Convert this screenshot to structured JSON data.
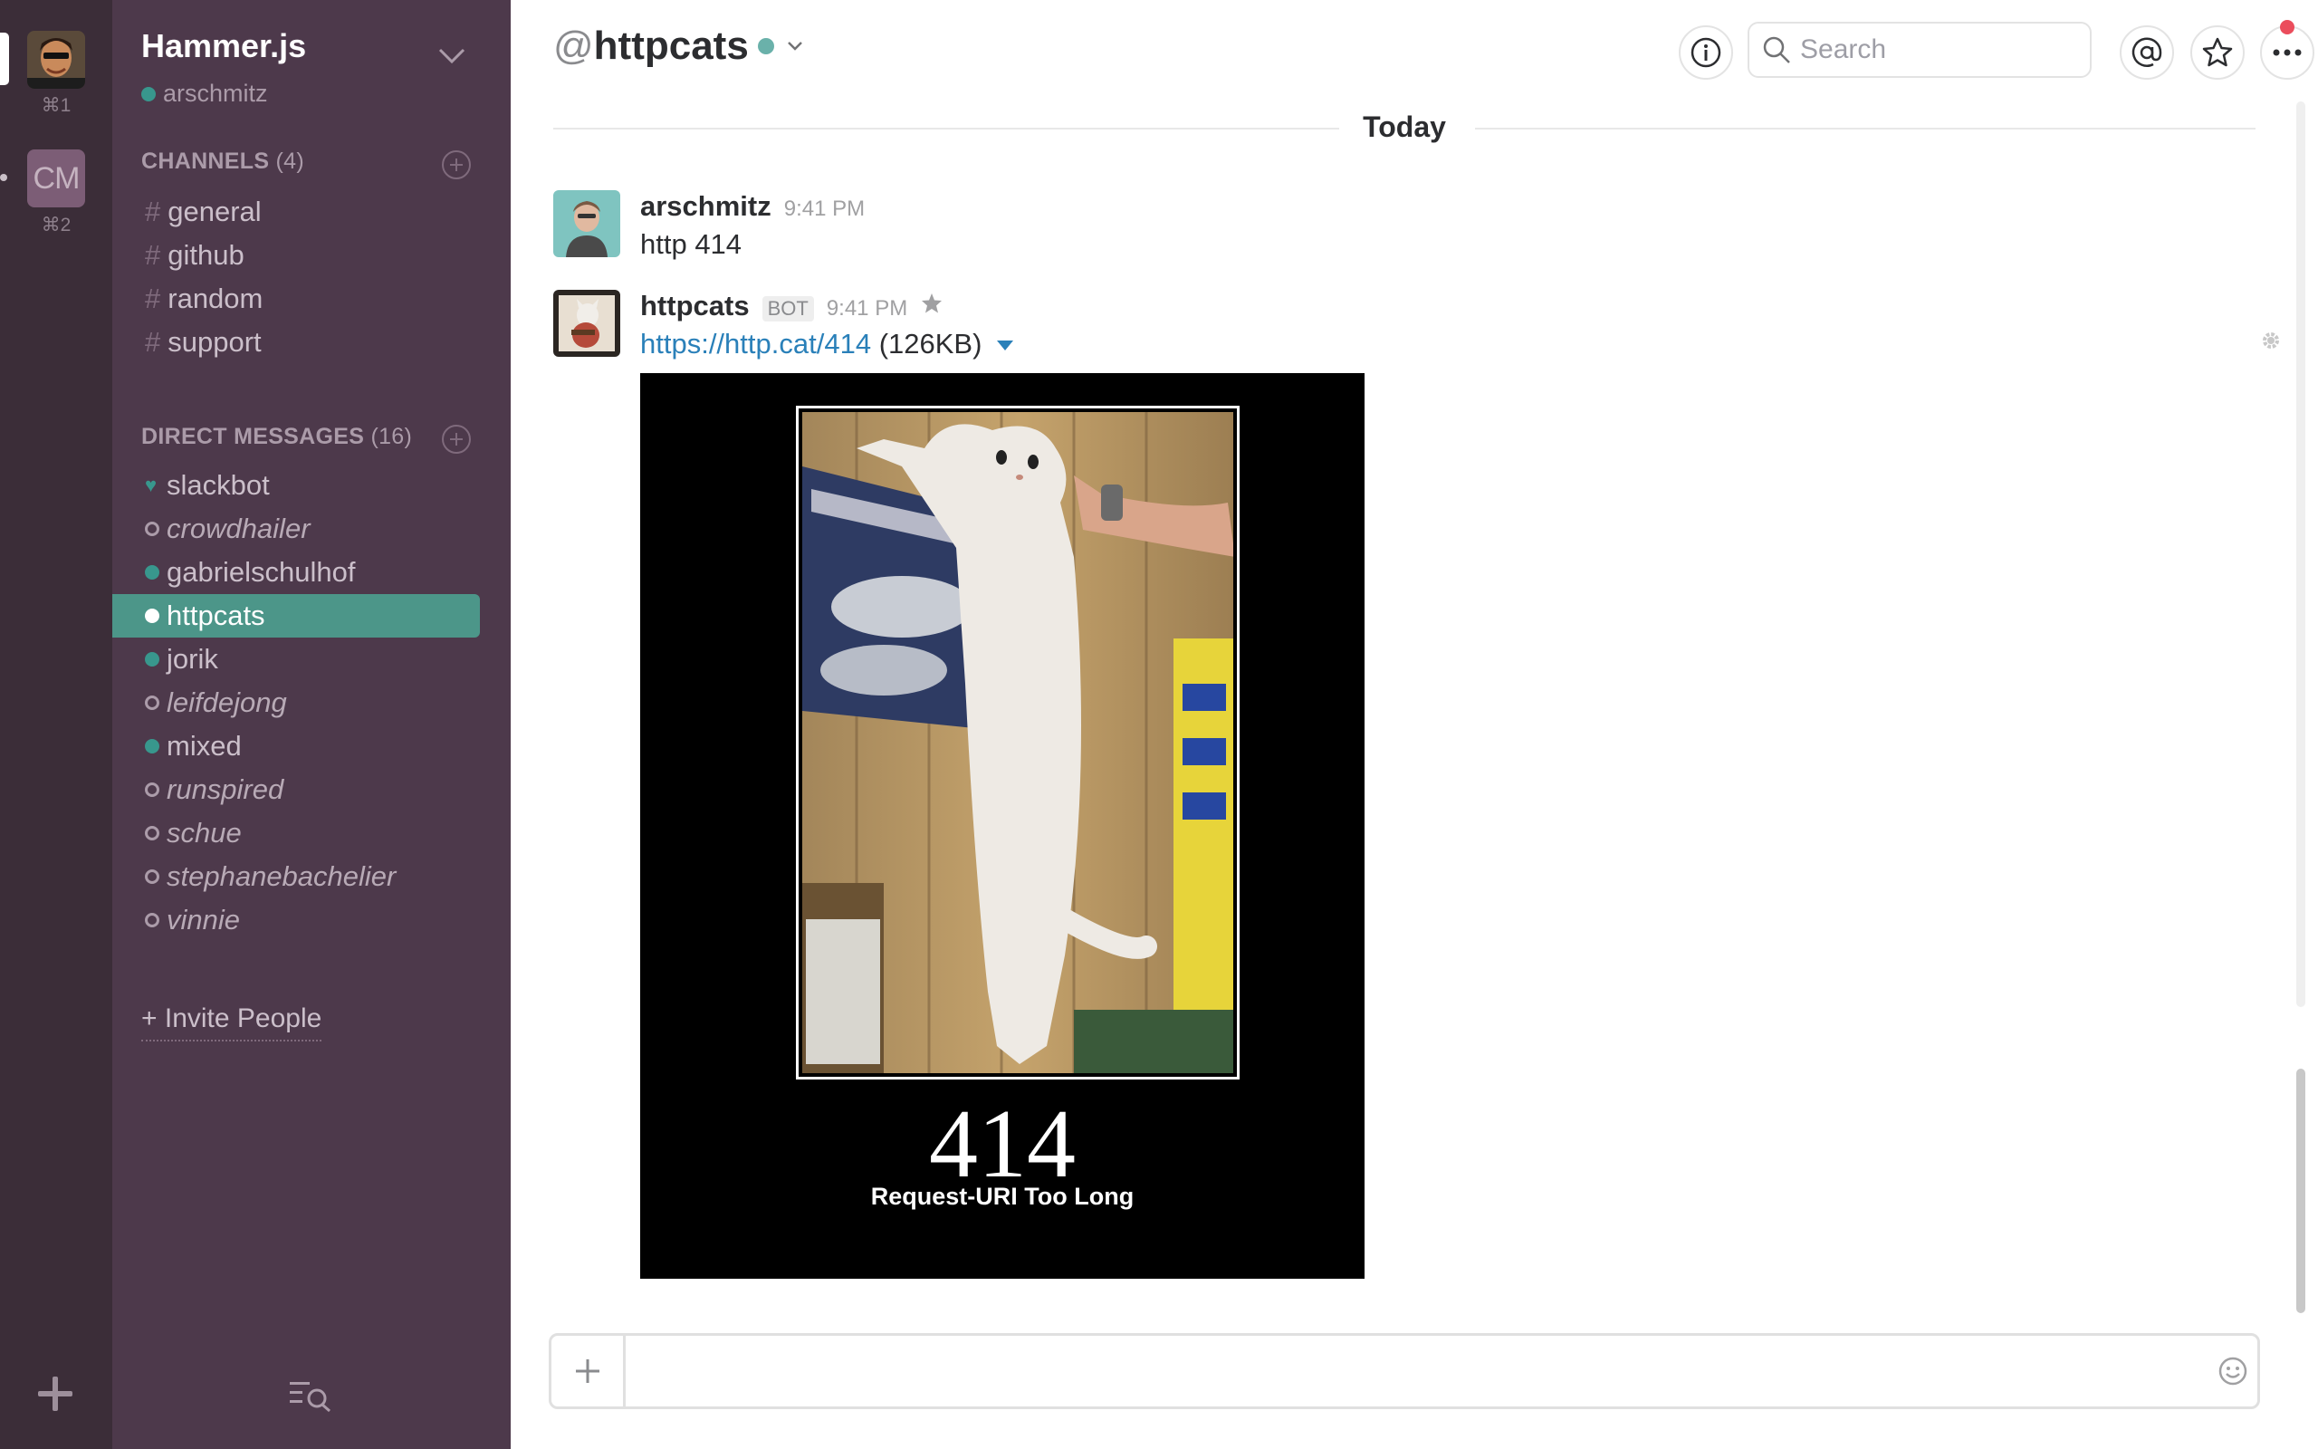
{
  "teams": [
    {
      "shortcut": "⌘1",
      "active": true
    },
    {
      "initials": "CM",
      "shortcut": "⌘2",
      "active": false
    }
  ],
  "sidebar": {
    "team_name": "Hammer.js",
    "user": "arschmitz",
    "channels_heading": "CHANNELS",
    "channels_count": "(4)",
    "channels": [
      {
        "hash": "#",
        "label": "general"
      },
      {
        "hash": "#",
        "label": "github"
      },
      {
        "hash": "#",
        "label": "random"
      },
      {
        "hash": "#",
        "label": "support"
      }
    ],
    "dms_heading": "DIRECT MESSAGES",
    "dms_count": "(16)",
    "dms": [
      {
        "label": "slackbot",
        "status": "bot"
      },
      {
        "label": "crowdhailer",
        "status": "offline"
      },
      {
        "label": "gabrielschulhof",
        "status": "online"
      },
      {
        "label": "httpcats",
        "status": "active"
      },
      {
        "label": "jorik",
        "status": "online"
      },
      {
        "label": "leifdejong",
        "status": "offline"
      },
      {
        "label": "mixed",
        "status": "online"
      },
      {
        "label": "runspired",
        "status": "offline"
      },
      {
        "label": "schue",
        "status": "offline"
      },
      {
        "label": "stephanebachelier",
        "status": "offline"
      },
      {
        "label": "vinnie",
        "status": "offline"
      }
    ],
    "invite_label": "+ Invite People"
  },
  "header": {
    "at": "@",
    "channel": "httpcats",
    "search_placeholder": "Search"
  },
  "divider": {
    "label": "Today"
  },
  "messages": [
    {
      "author": "arschmitz",
      "time": "9:41 PM",
      "text": "http 414"
    },
    {
      "author": "httpcats",
      "badge": "BOT",
      "time": "9:41 PM",
      "link": "https://http.cat/414",
      "size": "(126KB)",
      "image": {
        "code": "414",
        "description": "Request-URI Too Long"
      }
    }
  ],
  "composer": {
    "placeholder": ""
  },
  "colors": {
    "rail": "#3b2d38",
    "sidebar": "#4d394b",
    "active_item": "#4c9689",
    "presence_online": "#38978d",
    "link": "#2a80b9",
    "notification": "#eb4d5c"
  }
}
